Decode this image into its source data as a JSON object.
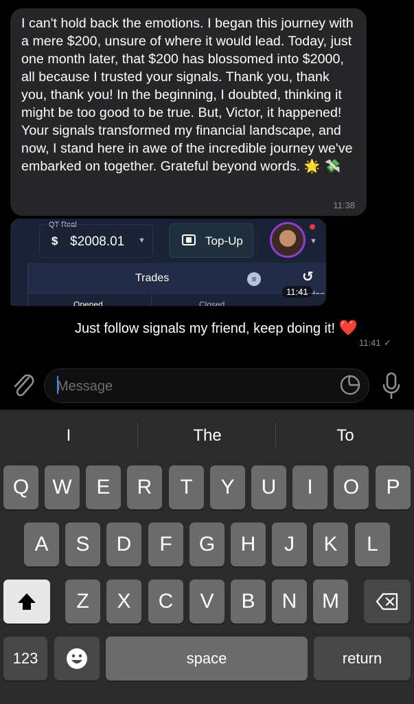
{
  "incoming_message": {
    "text": "I can't hold back the emotions. I began this journey with a mere $200, unsure of where it would lead. Today, just one month later, that $200 has blossomed into $2000, all because I trusted your signals. Thank you, thank you, thank you! In the beginning, I doubted, thinking it might be too good to be true. But, Victor, it happened! Your signals transformed my financial landscape, and now, I stand here in awe of the incredible journey we've embarked on together. Grateful beyond words.",
    "emoji": "🌟 💸",
    "time": "11:38"
  },
  "screenshot_image": {
    "account_label": "QT Real",
    "balance": "$2008.01",
    "topup_label": "Top-Up",
    "trades_title": "Trades",
    "history_label": "Trades",
    "tab_opened": "Opened",
    "tab_closed": "Closed",
    "time": "11:41"
  },
  "outgoing_message": {
    "text": "Just follow signals my friend, keep doing it!",
    "emoji": "❤️",
    "time": "11:41",
    "status_icon": "double-check-icon"
  },
  "input_bar": {
    "placeholder": "Message",
    "icons": [
      "paperclip-icon",
      "sticker-icon",
      "microphone-icon"
    ]
  },
  "keyboard": {
    "suggestions": [
      "I",
      "The",
      "To"
    ],
    "row1": [
      "Q",
      "W",
      "E",
      "R",
      "T",
      "Y",
      "U",
      "I",
      "O",
      "P"
    ],
    "row2": [
      "A",
      "S",
      "D",
      "F",
      "G",
      "H",
      "J",
      "K",
      "L"
    ],
    "row3": [
      "Z",
      "X",
      "C",
      "V",
      "B",
      "N",
      "M"
    ],
    "numbers_label": "123",
    "space_label": "space",
    "return_label": "return"
  },
  "colors": {
    "bubble_incoming": "#262628",
    "keyboard_bg": "#2b2b2b",
    "key_bg": "#6b6b6b",
    "accent": "#3a86ff",
    "heart": "#e0242d"
  }
}
